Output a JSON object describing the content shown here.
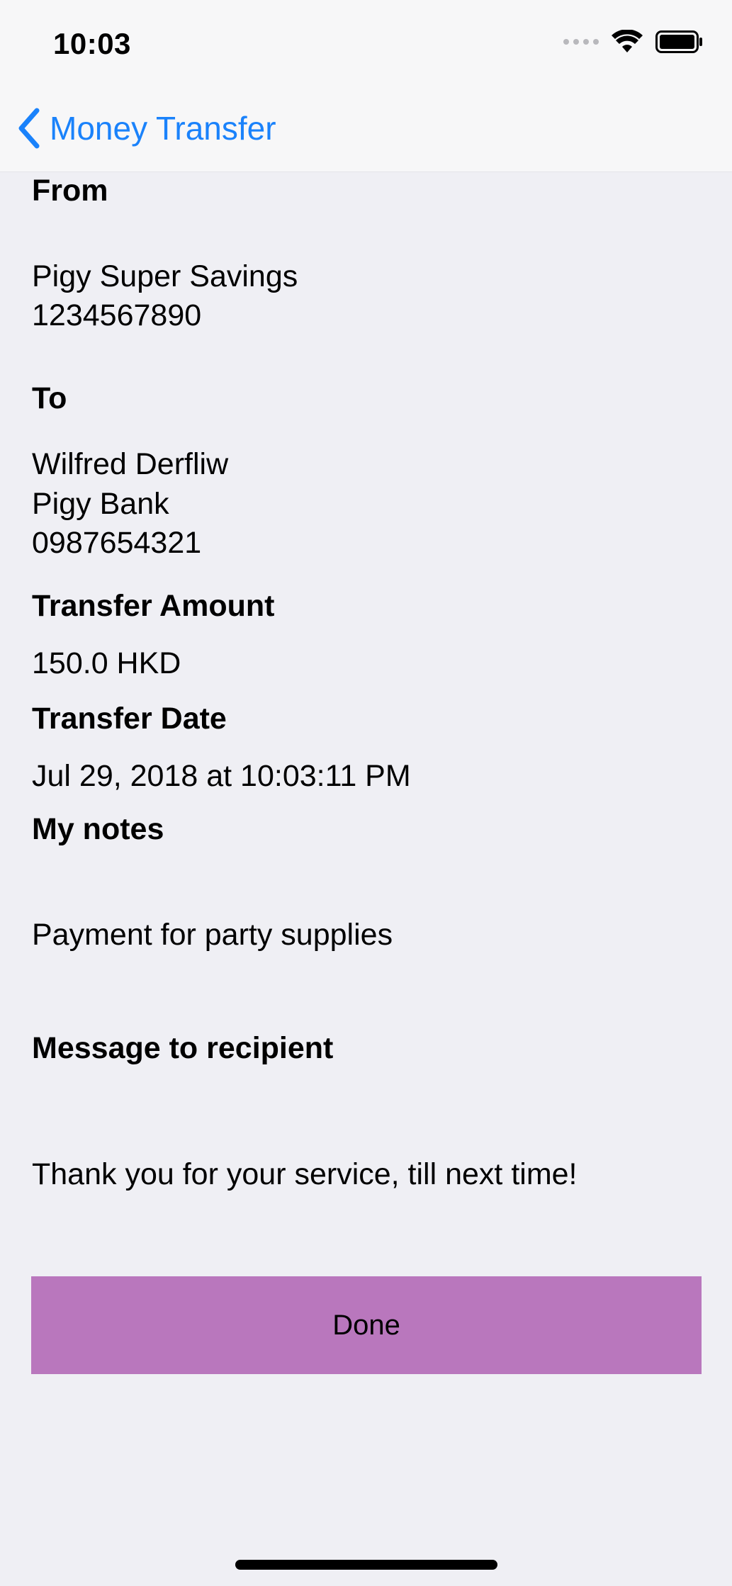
{
  "status_bar": {
    "time": "10:03"
  },
  "nav": {
    "back_label": "Money Transfer"
  },
  "from": {
    "heading": "From",
    "account_name": "Pigy Super Savings",
    "account_number": "1234567890"
  },
  "to": {
    "heading": "To",
    "name": "Wilfred Derfliw",
    "bank": "Pigy Bank",
    "account_number": "0987654321"
  },
  "amount": {
    "heading": "Transfer Amount",
    "value": "150.0 HKD"
  },
  "date": {
    "heading": "Transfer Date",
    "value": "Jul 29, 2018 at 10:03:11 PM"
  },
  "notes": {
    "heading": "My notes",
    "value": "Payment for party supplies"
  },
  "message": {
    "heading": "Message to recipient",
    "value": "Thank you for your service, till next time!"
  },
  "actions": {
    "done_label": "Done"
  },
  "colors": {
    "accent": "#1a82fb",
    "button": "#b977bd",
    "background": "#efeff4"
  }
}
